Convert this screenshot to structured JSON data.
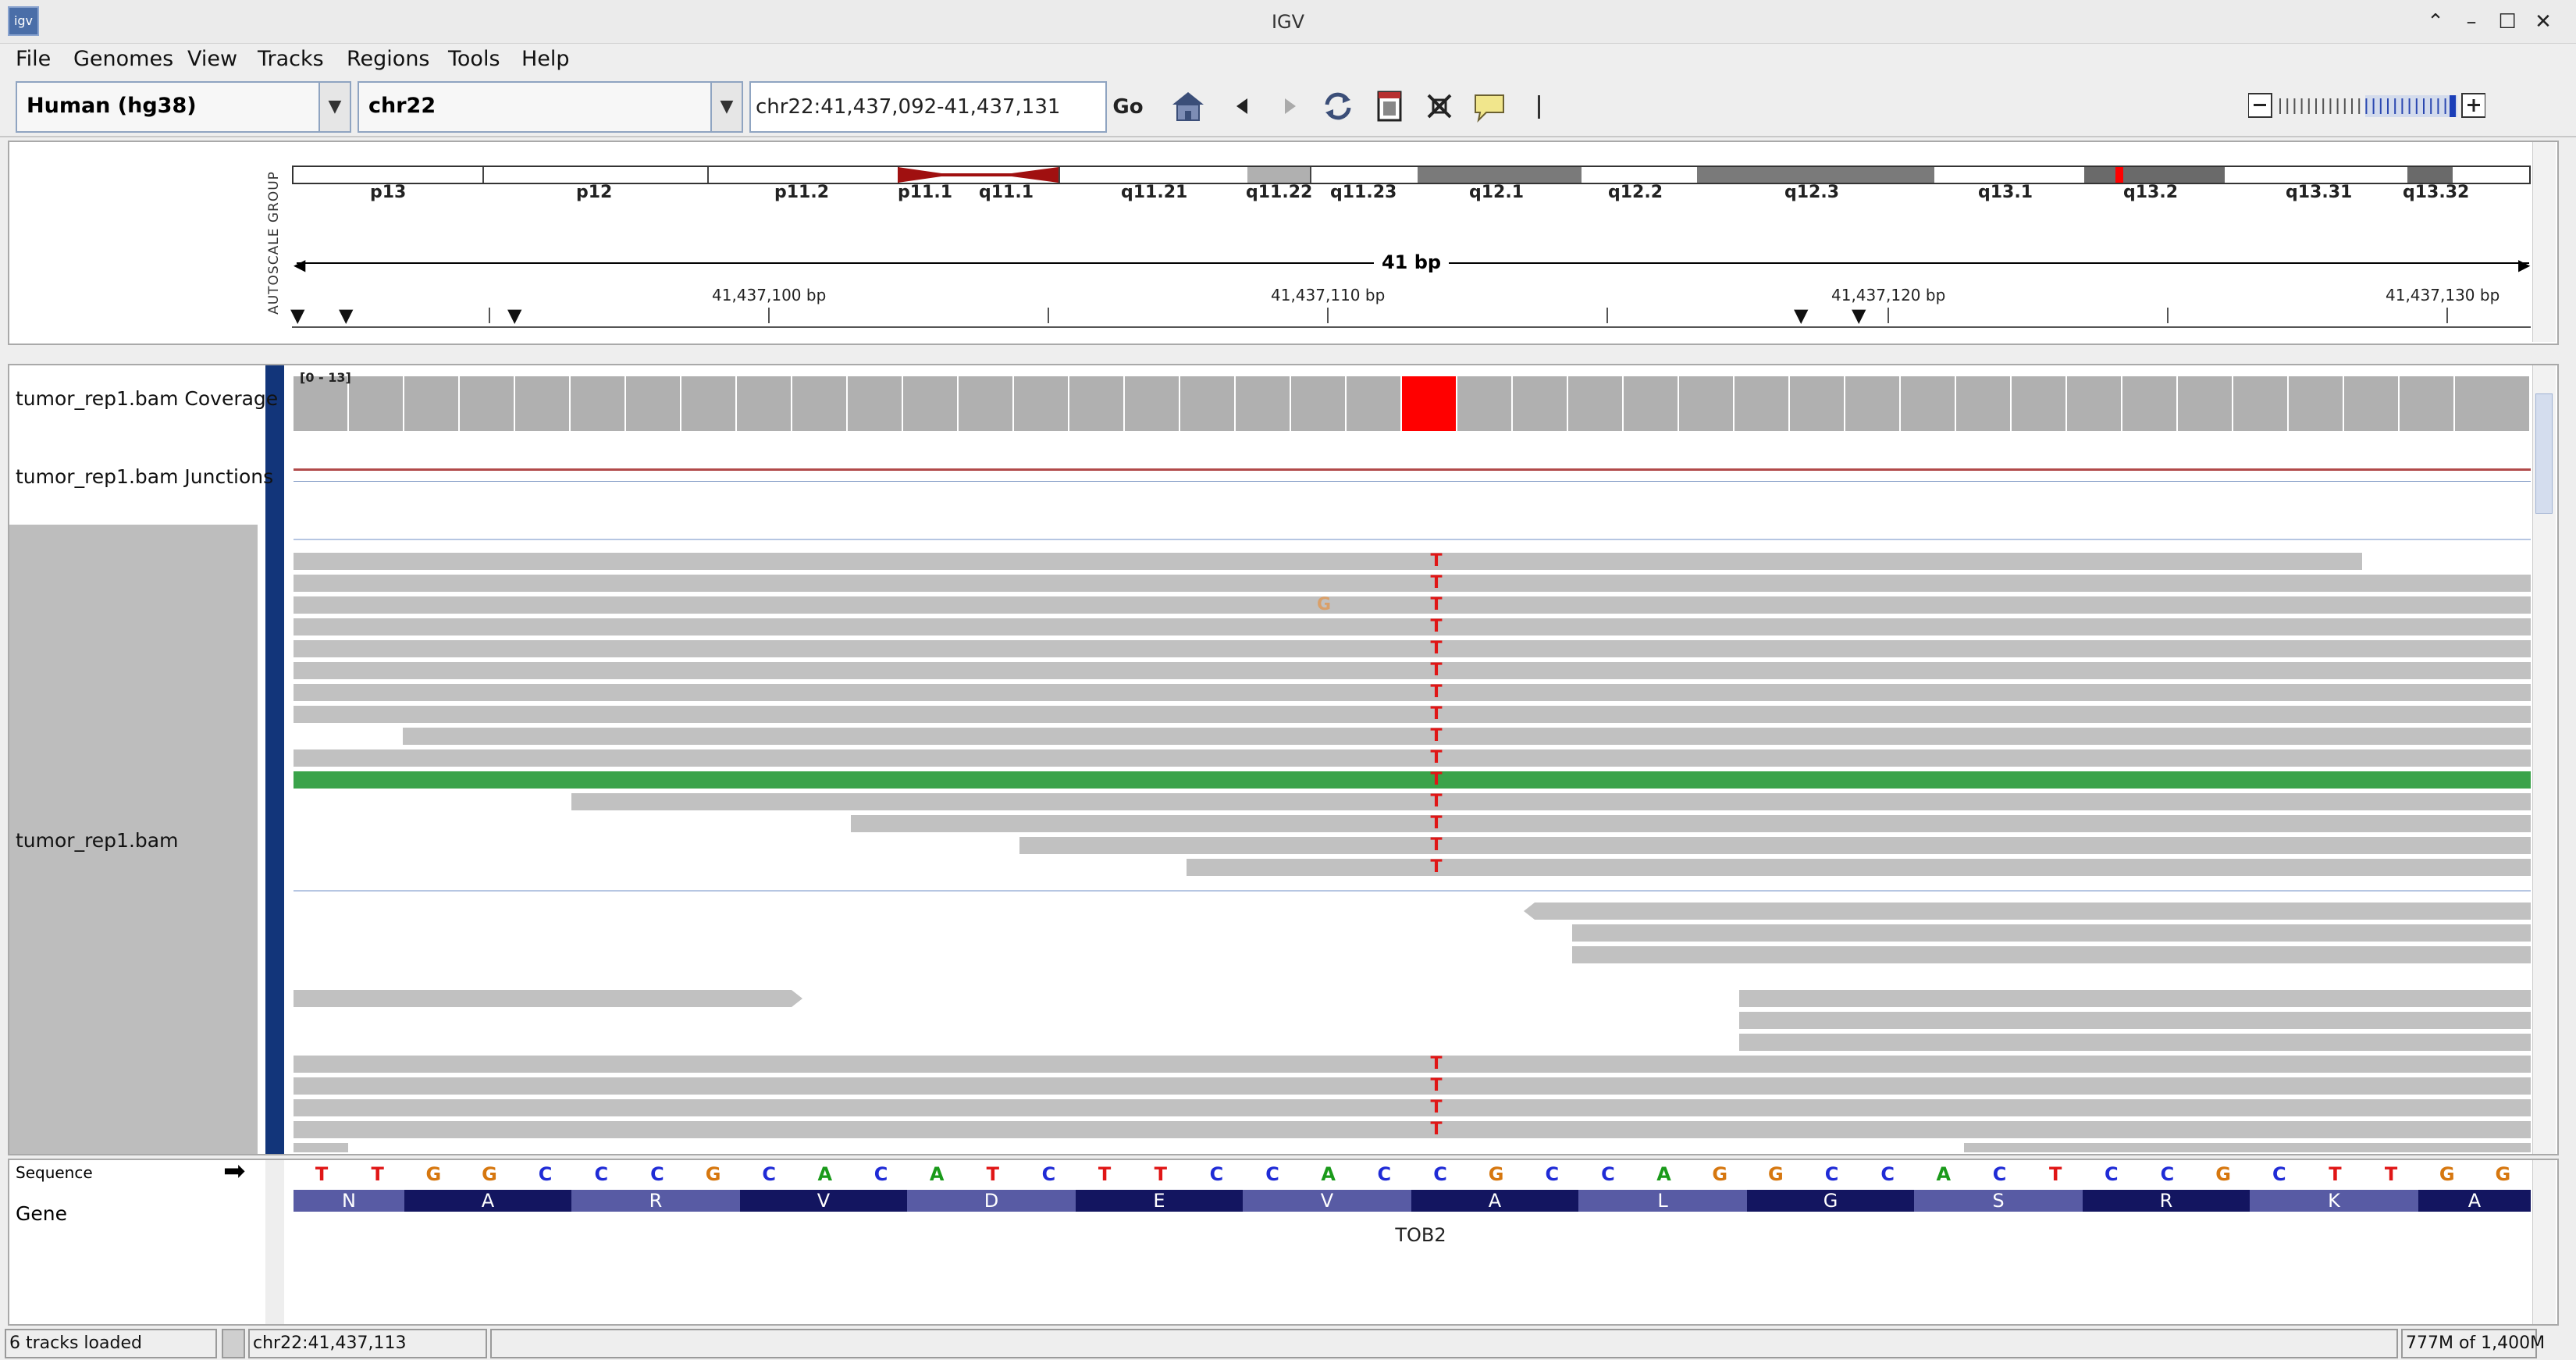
{
  "window": {
    "title": "IGV",
    "app_icon": "igv-app-icon",
    "controls": [
      "minimize-caret",
      "minimize",
      "maximize",
      "close"
    ]
  },
  "menu": {
    "items": [
      "File",
      "Genomes",
      "View",
      "Tracks",
      "Regions",
      "Tools",
      "Help"
    ]
  },
  "toolbar": {
    "genome": "Human (hg38)",
    "chromosome": "chr22",
    "locus": "chr22:41,437,092-41,437,131",
    "go_label": "Go",
    "icons": [
      "home-icon",
      "back-icon",
      "forward-icon",
      "refresh-icon",
      "roi-icon",
      "fit-window-icon",
      "popup-text-icon",
      "divider"
    ]
  },
  "ideogram": {
    "bands": [
      "p13",
      "p12",
      "p11.2",
      "p11.1",
      "q11.1",
      "q11.21",
      "q11.22",
      "q11.23",
      "q12.1",
      "q12.2",
      "q12.3",
      "q13.1",
      "q13.2",
      "q13.31",
      "q13.32"
    ],
    "autoscale_label": "AUTOSCALE GROUP"
  },
  "ruler": {
    "span_label": "41 bp",
    "ticks": [
      "41,437,100 bp",
      "41,437,110 bp",
      "41,437,120 bp",
      "41,437,130 bp"
    ]
  },
  "tracks": {
    "coverage": "tumor_rep1.bam Coverage",
    "coverage_range": "[0 - 13]",
    "junctions": "tumor_rep1.bam Junctions",
    "alignments": "tumor_rep1.bam",
    "sequence": "Sequence",
    "gene": "Gene"
  },
  "mismatch_base": "T",
  "other_mismatch_base": "G",
  "sequence": [
    "T",
    "T",
    "G",
    "G",
    "C",
    "C",
    "C",
    "G",
    "C",
    "A",
    "C",
    "A",
    "T",
    "C",
    "T",
    "T",
    "C",
    "C",
    "A",
    "C",
    "C",
    "G",
    "C",
    "C",
    "A",
    "G",
    "G",
    "C",
    "C",
    "A",
    "C",
    "T",
    "C",
    "C",
    "G",
    "C",
    "T",
    "T",
    "G",
    "G"
  ],
  "amino_acids": [
    "N",
    "A",
    "R",
    "V",
    "D",
    "E",
    "V",
    "A",
    "L",
    "G",
    "S",
    "R",
    "K",
    "A"
  ],
  "gene_name": "TOB2",
  "base_colors": {
    "A": "#1a9a1a",
    "C": "#1f2bd6",
    "G": "#d6770f",
    "T": "#e01616"
  },
  "status": {
    "tracks_loaded": "6 tracks loaded",
    "position": "chr22:41,437,113",
    "memory": "777M of 1,400M"
  }
}
